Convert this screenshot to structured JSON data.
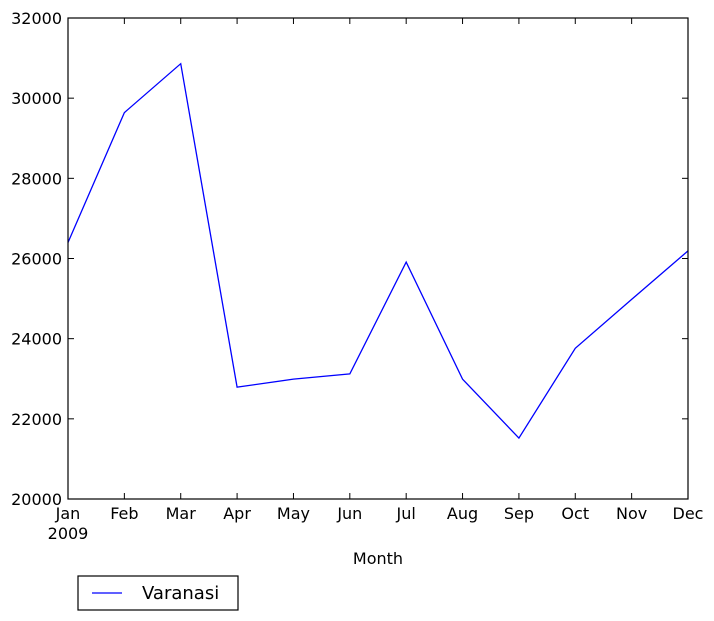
{
  "chart_data": {
    "type": "line",
    "title": "",
    "xlabel": "Month",
    "ylabel": "",
    "categories": [
      "Jan",
      "Feb",
      "Mar",
      "Apr",
      "May",
      "Jun",
      "Jul",
      "Aug",
      "Sep",
      "Oct",
      "Nov",
      "Dec"
    ],
    "year_label": "2009",
    "ylim": [
      20000,
      32000
    ],
    "yticks": [
      "20000",
      "22000",
      "24000",
      "26000",
      "28000",
      "30000",
      "32000"
    ],
    "grid": false,
    "legend_position": "below-left",
    "series": [
      {
        "name": "Varanasi",
        "color": "#0000ff",
        "values": [
          26400,
          29640,
          30860,
          22790,
          22990,
          23120,
          25910,
          22990,
          21520,
          23760,
          24980,
          26190
        ]
      }
    ]
  }
}
